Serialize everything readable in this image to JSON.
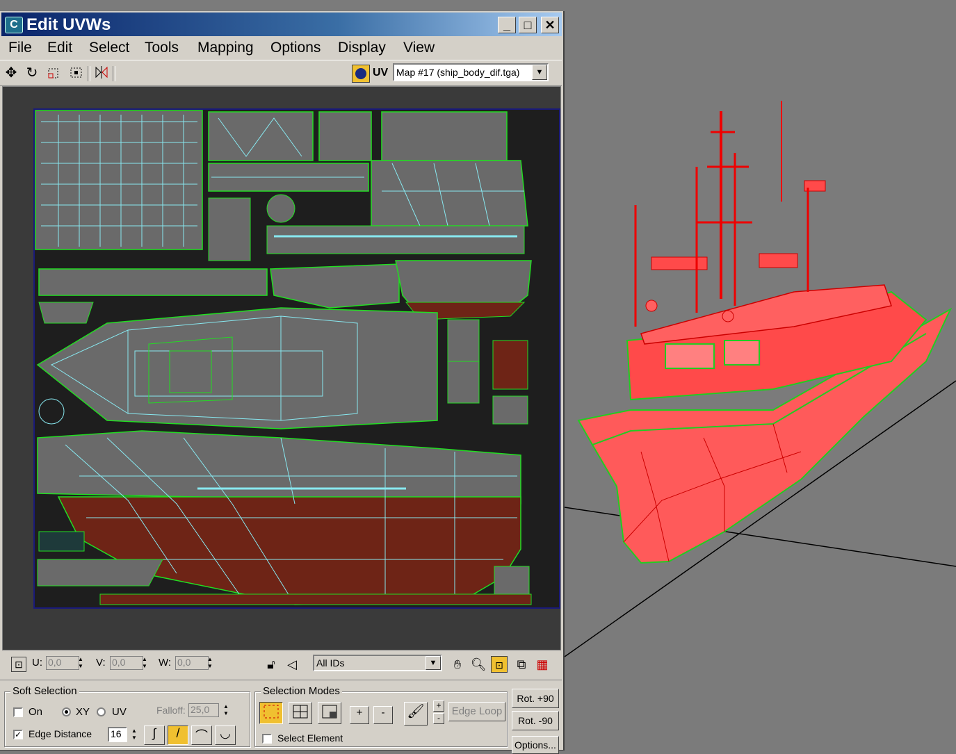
{
  "window": {
    "title": "Edit UVWs",
    "app_icon": "C",
    "minimize": "_",
    "maximize": "□",
    "close": "✕"
  },
  "menu": [
    "File",
    "Edit",
    "Select",
    "Tools",
    "Mapping",
    "Options",
    "Display",
    "View"
  ],
  "toolbar": {
    "icons": [
      "move-icon",
      "rotate-icon",
      "scale-icon",
      "freeform-icon",
      "mirror-icon"
    ],
    "uv_label": "UV",
    "map_select_value": "Map #17 (ship_body_dif.tga)"
  },
  "status": {
    "u_label": "U:",
    "u_value": "0,0",
    "v_label": "V:",
    "v_value": "0,0",
    "w_label": "W:",
    "w_value": "0,0",
    "ids_value": "All IDs"
  },
  "soft_selection": {
    "title": "Soft Selection",
    "on_label": "On",
    "on_checked": false,
    "xy_label": "XY",
    "xy_selected": true,
    "uv_label": "UV",
    "falloff_label": "Falloff:",
    "falloff_value": "25,0",
    "edge_distance_label": "Edge Distance",
    "edge_distance_checked": true,
    "edge_distance_value": "16"
  },
  "selection_modes": {
    "title": "Selection Modes",
    "plus": "+",
    "minus": "-",
    "edge_loop": "Edge Loop",
    "select_element_label": "Select Element",
    "select_element_checked": false
  },
  "side_buttons": {
    "rot_plus": "Rot. +90",
    "rot_minus": "Rot. -90",
    "options": "Options..."
  },
  "colors": {
    "wire_green": "#22dd22",
    "wire_cyan": "#88e8f0",
    "ship_red": "#ff5a5a",
    "hull_rust": "#6e2416",
    "panel_grey": "#6a6a6a",
    "title_blue": "#0a246a"
  }
}
